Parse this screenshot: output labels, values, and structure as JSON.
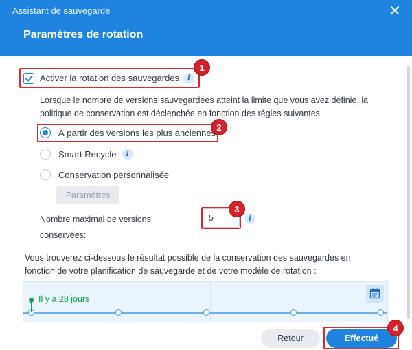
{
  "window": {
    "title": "Assistant de sauvegarde"
  },
  "header": {
    "title": "Paramètres de rotation"
  },
  "rotation": {
    "enable_label": "Activer la rotation des sauvegardes",
    "enabled": true,
    "description": "Lorsque le nombre de versions sauvegardées atteint la limite que vous avez définie, la politique de conservation est déclenchée en fonction des règles suivantes",
    "options": [
      {
        "label": "À partir des versions les plus anciennes",
        "selected": true
      },
      {
        "label": "Smart Recycle",
        "selected": false
      },
      {
        "label": "Conservation personnalisée",
        "selected": false
      }
    ],
    "settings_button": "Paramètres",
    "max_versions_label": "Nombre maximal de versions conservées:",
    "max_versions_value": "5"
  },
  "result": {
    "description": "Vous trouverez ci-dessous le résultat possible de la conservation des sauvegardes en fonction de votre planification de sauvegarde et de votre modèle de rotation :",
    "timeline_marker": "Il y a 28 jours"
  },
  "footer": {
    "back_label": "Retour",
    "done_label": "Effectué"
  },
  "callouts": [
    "1",
    "2",
    "3",
    "4"
  ],
  "colors": {
    "accent": "#1f83e0",
    "callout": "#dc2a2a",
    "marker": "#14a04a"
  },
  "icons": [
    "close-icon",
    "checkmark-icon",
    "info-icon",
    "calendar-icon"
  ]
}
